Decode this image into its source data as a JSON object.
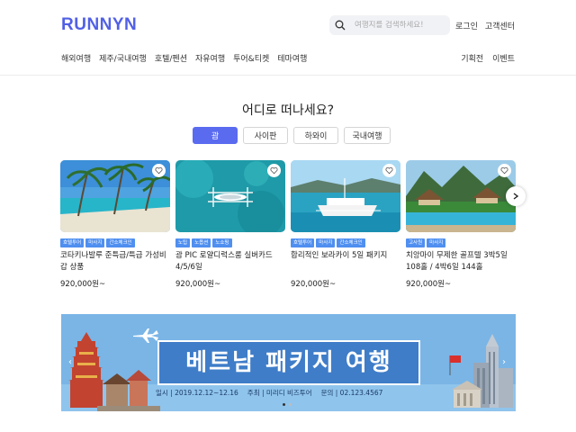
{
  "header": {
    "logo": "RUNNYN",
    "search_placeholder": "여행지를 검색하세요!",
    "top_links": [
      "로그인",
      "고객센터"
    ],
    "nav": [
      "해외여행",
      "제주/국내여행",
      "호텔/펜션",
      "자유여행",
      "투어&티켓",
      "테마여행"
    ],
    "nav_right": [
      "기획전",
      "이벤트"
    ]
  },
  "section": {
    "title": "어디로 떠나세요?",
    "tabs": [
      {
        "label": "괌",
        "active": true
      },
      {
        "label": "사이판",
        "active": false
      },
      {
        "label": "하와이",
        "active": false
      },
      {
        "label": "국내여행",
        "active": false
      }
    ]
  },
  "cards": [
    {
      "tags": [
        "호텔투어",
        "마사지",
        "간소체크인"
      ],
      "title": "코타키나발루 준특급/특급 가성비갑 상품",
      "price": "920,000원~"
    },
    {
      "tags": [
        "노팁",
        "노옵션",
        "노쇼핑"
      ],
      "title": "괌 PIC 로얄디럭스룸 실버카드 4/5/6일",
      "price": "920,000원~"
    },
    {
      "tags": [
        "호텔투어",
        "마사지",
        "간소체크인"
      ],
      "title": "합리적인 보라카이 5일 패키지",
      "price": "920,000원~"
    },
    {
      "tags": [
        "고사원",
        "마사지"
      ],
      "title": "치앙마이 무제한 골프텔 3박5일 108홀 / 4박6일 144홀",
      "price": "920,000원~"
    }
  ],
  "banner": {
    "title": "베트남 패키지 여행",
    "info": [
      "일시 | 2019.12.12~12.16",
      "주최 | 미리디 비즈투어",
      "문의 | 02.123.4567"
    ]
  },
  "colors": {
    "brand": "#5160e6",
    "tab_active": "#5a6bf0",
    "tag": "#4f8ff0",
    "banner_bg": "#7ab5e6"
  }
}
